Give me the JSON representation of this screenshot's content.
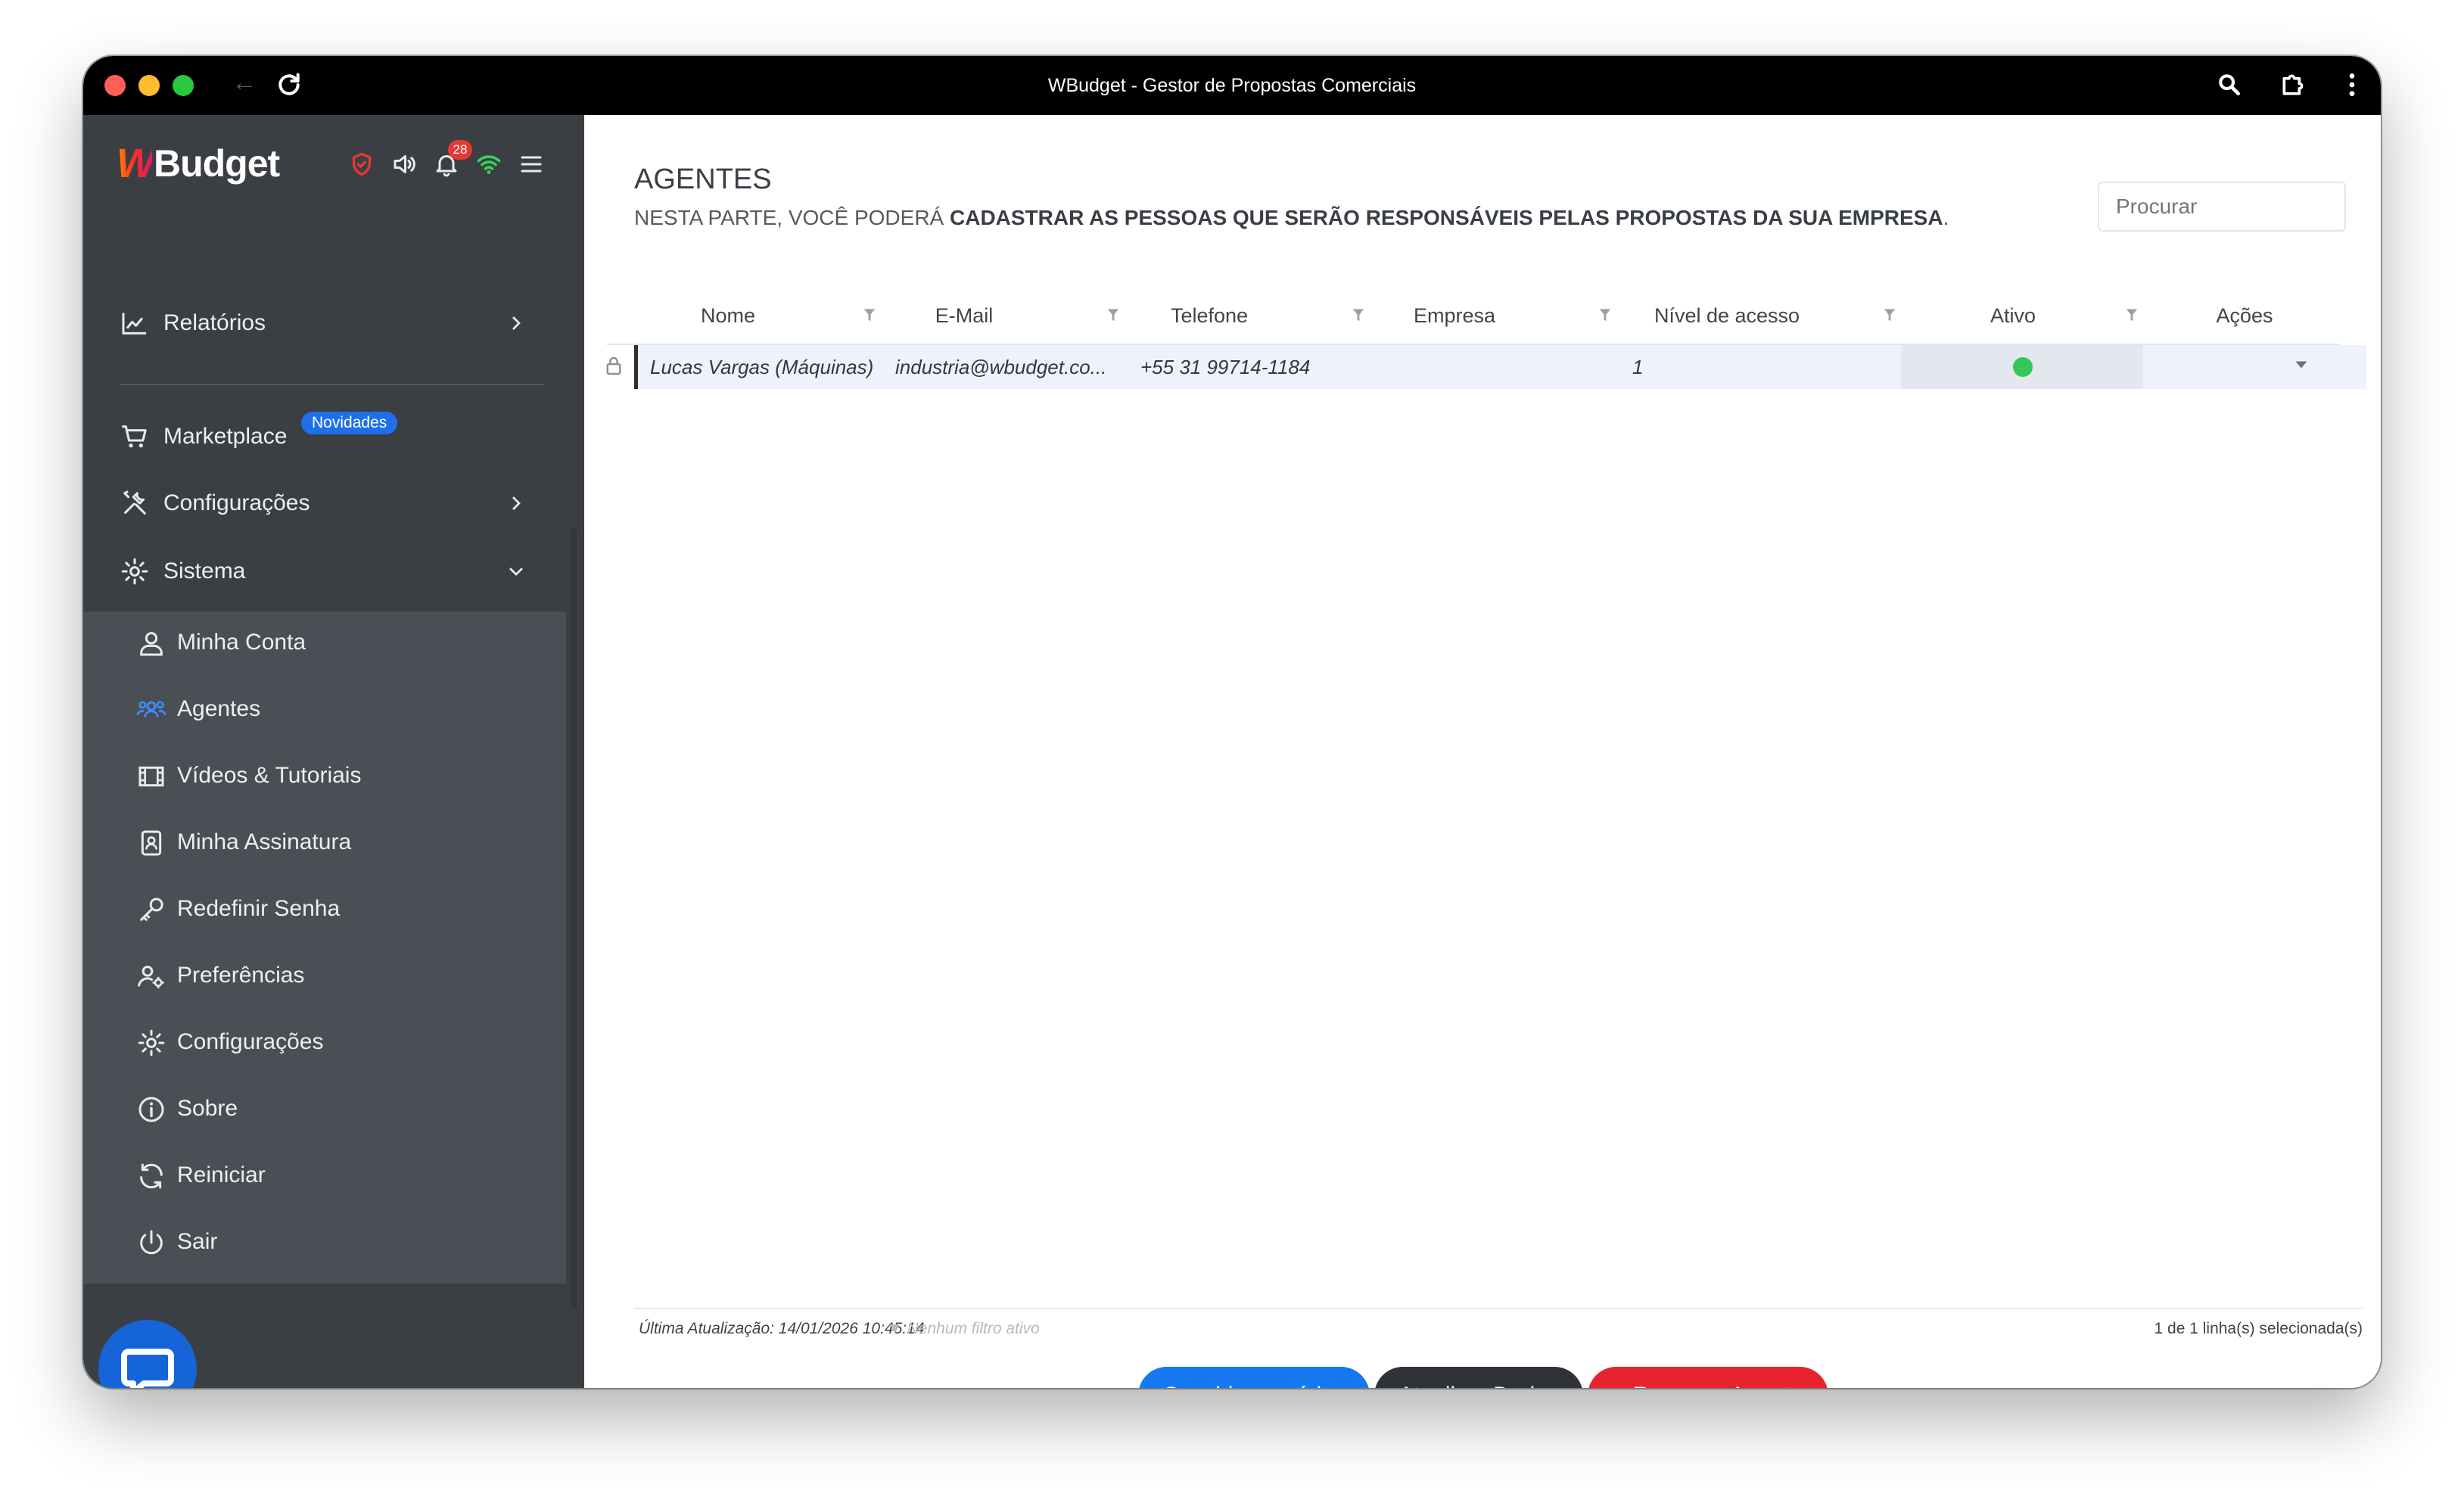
{
  "window": {
    "title": "WBudget - Gestor de Propostas Comerciais"
  },
  "sidebar": {
    "logo_w": "W",
    "logo_text": "Budget",
    "notifications_count": "28",
    "items": [
      {
        "label": "Relatórios",
        "icon": "chart-icon"
      },
      {
        "label": "Marketplace",
        "icon": "cart-icon",
        "badge": "Novidades"
      },
      {
        "label": "Configurações",
        "icon": "tools-icon"
      },
      {
        "label": "Sistema",
        "icon": "gear-icon"
      }
    ],
    "submenu": [
      {
        "label": "Minha Conta",
        "icon": "user-icon"
      },
      {
        "label": "Agentes",
        "icon": "users-icon"
      },
      {
        "label": "Vídeos & Tutoriais",
        "icon": "film-icon"
      },
      {
        "label": "Minha Assinatura",
        "icon": "id-badge-icon"
      },
      {
        "label": "Redefinir Senha",
        "icon": "key-icon"
      },
      {
        "label": "Preferências",
        "icon": "user-settings-icon"
      },
      {
        "label": "Configurações",
        "icon": "gear-icon"
      },
      {
        "label": "Sobre",
        "icon": "info-icon"
      },
      {
        "label": "Reiniciar",
        "icon": "refresh-icon"
      },
      {
        "label": "Sair",
        "icon": "power-icon"
      }
    ]
  },
  "main": {
    "title": "AGENTES",
    "subtitle_prefix": "NESTA PARTE, VOCÊ PODERÁ ",
    "subtitle_bold": "CADASTRAR AS PESSOAS QUE SERÃO RESPONSÁVEIS PELAS PROPOSTAS DA SUA EMPRESA",
    "subtitle_suffix": ".",
    "search_placeholder": "Procurar",
    "columns": [
      "Nome",
      "E-Mail",
      "Telefone",
      "Empresa",
      "Nível de acesso",
      "Ativo",
      "Ações"
    ],
    "rows": [
      {
        "nome": "Lucas Vargas (Máquinas)",
        "email": "industria@wbudget.co...",
        "telefone": "+55 31 99714-1184",
        "empresa": "",
        "nivel": "1",
        "ativo": true
      }
    ],
    "footer": {
      "last_update": "Última Atualização: 14/01/2026 10:45:14",
      "filter_status": "Nenhum filtro ativo",
      "selection": "1 de 1 linha(s) selecionada(s)"
    },
    "buttons": {
      "invite": "Convidar usuários",
      "refresh": "Atualizar Dados",
      "remove": "– Remover Agente"
    }
  },
  "colors": {
    "sidebar_bg": "#3b3f44",
    "submenu_bg": "#4a4f55",
    "accent_blue": "#1478f0",
    "danger_red": "#e8232e",
    "active_green": "#34c759"
  }
}
